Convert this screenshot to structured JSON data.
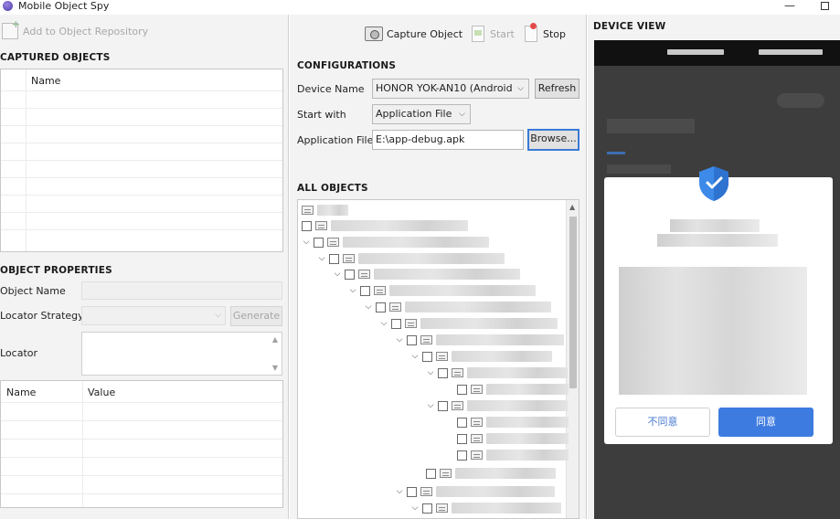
{
  "window": {
    "title": "Mobile Object Spy",
    "minimize_glyph": "—"
  },
  "left": {
    "add_to_repo_label": "Add to Object Repository",
    "captured_objects_title": "CAPTURED OBJECTS",
    "captured_col_name": "Name",
    "object_properties_title": "OBJECT PROPERTIES",
    "object_name_label": "Object Name",
    "object_name_value": "",
    "locator_strategy_label": "Locator Strategy",
    "generate_label": "Generate",
    "locator_label": "Locator",
    "prop_col_name": "Name",
    "prop_col_value": "Value"
  },
  "center": {
    "capture_object_label": "Capture Object",
    "start_label": "Start",
    "stop_label": "Stop",
    "configurations_title": "CONFIGURATIONS",
    "device_name_label": "Device Name",
    "device_name_value": "HONOR YOK-AN10 (Android",
    "refresh_label": "Refresh",
    "start_with_label": "Start with",
    "start_with_value": "Application File",
    "application_file_label": "Application File",
    "application_file_value": "E:\\app-debug.apk",
    "browse_label": "Browse...",
    "all_objects_title": "ALL OBJECTS"
  },
  "device": {
    "title": "DEVICE VIEW",
    "reject_label": "不同意",
    "accept_label": "同意",
    "accent_color": "#3d7be0"
  }
}
